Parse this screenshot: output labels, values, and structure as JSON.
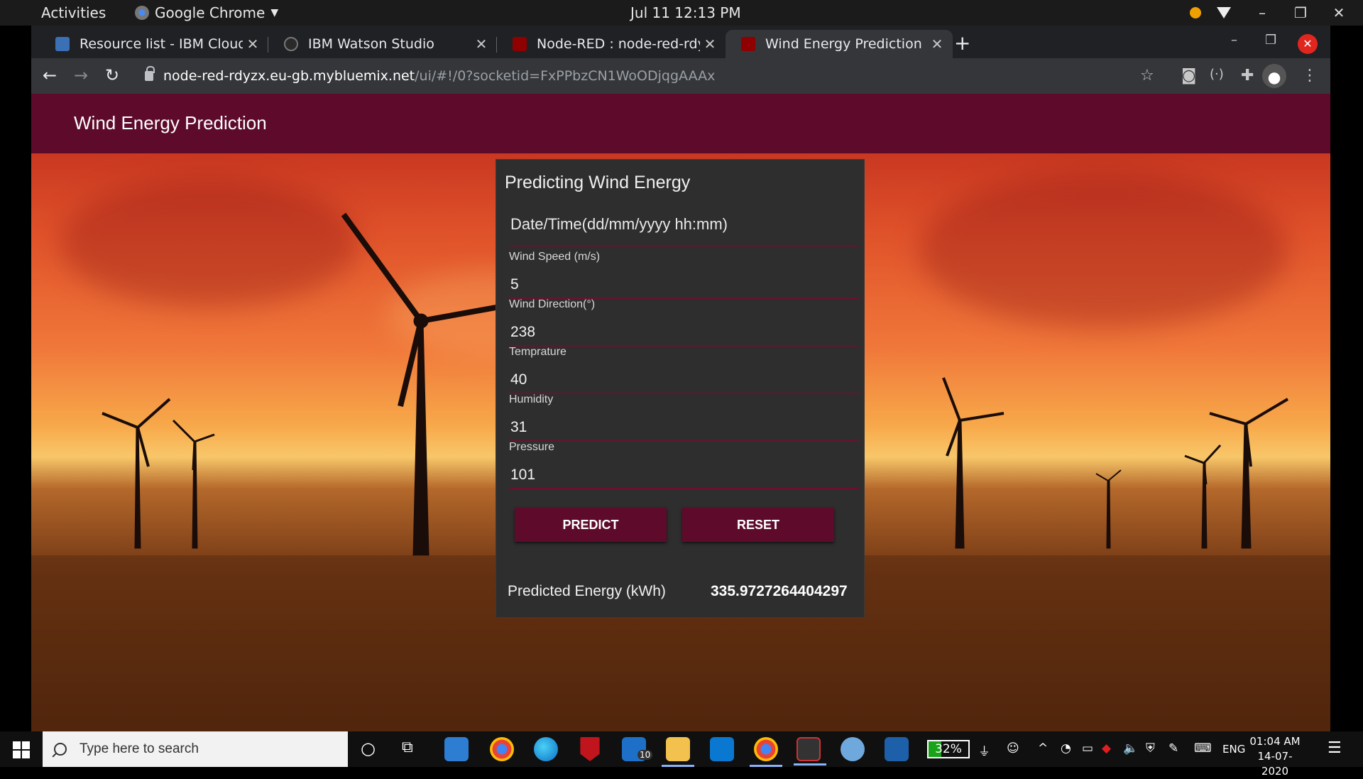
{
  "gnome": {
    "activities": "Activities",
    "app_name": "Google Chrome",
    "clock": "Jul 11  12:13 PM"
  },
  "browser": {
    "tabs": [
      {
        "title": "Resource list - IBM Cloud",
        "active": false
      },
      {
        "title": "IBM Watson Studio",
        "active": false
      },
      {
        "title": "Node-RED : node-red-rdyz",
        "active": false
      },
      {
        "title": "Wind Energy Prediction",
        "active": true
      }
    ],
    "new_tab": "+",
    "url_host": "node-red-rdyzx.eu-gb.mybluemix.net",
    "url_path": "/ui/#!/0?socketid=FxPPbzCN1WoODjqgAAAx"
  },
  "page": {
    "header_title": "Wind Energy Prediction",
    "card_title": "Predicting Wind Energy",
    "datetime_placeholder": "Date/Time(dd/mm/yyyy hh:mm)",
    "fields": [
      {
        "label": "Wind Speed (m/s)",
        "value": "5"
      },
      {
        "label": "Wind Direction(°)",
        "value": "238"
      },
      {
        "label": "Temprature",
        "value": "40"
      },
      {
        "label": "Humidity",
        "value": "31"
      },
      {
        "label": "Pressure",
        "value": "101"
      }
    ],
    "predict_label": "PREDICT",
    "reset_label": "RESET",
    "result_label": "Predicted Energy (kWh)",
    "result_value": "335.9727264404297"
  },
  "taskbar": {
    "search_placeholder": "Type here to search",
    "mail_badge": "10",
    "battery": "32%",
    "lang": "ENG",
    "time": "01:04 AM",
    "date": "14-07-2020"
  },
  "colors": {
    "accent": "#5e0b2b",
    "card_bg": "#2e2e2e"
  }
}
